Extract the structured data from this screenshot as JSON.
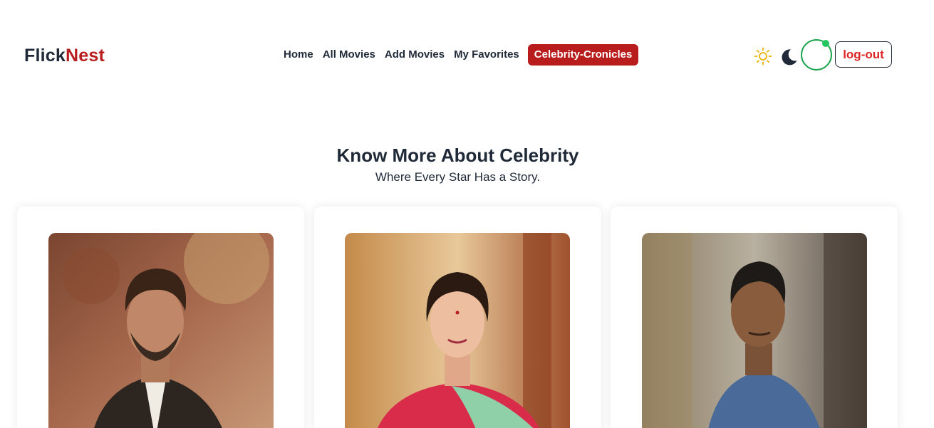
{
  "brand": {
    "part1": "Flick",
    "part2": "Nest",
    "accent_color": "#b91c1c"
  },
  "nav": {
    "links": [
      {
        "label": "Home"
      },
      {
        "label": "All Movies"
      },
      {
        "label": "Add Movies"
      },
      {
        "label": "My Favorites"
      },
      {
        "label": "Celebrity-Cronicles",
        "active": true
      }
    ],
    "theme_icons": [
      "sun-icon",
      "moon-icon"
    ],
    "avatar_status_color": "#22c55e",
    "logout_label": "log-out"
  },
  "hero": {
    "title": "Know More About Celebrity",
    "subtitle": "Where Every Star Has a Story."
  },
  "celebrities": [
    {
      "photo": "celebrity-photo"
    },
    {
      "photo": "celebrity-photo"
    },
    {
      "photo": "celebrity-photo"
    }
  ]
}
